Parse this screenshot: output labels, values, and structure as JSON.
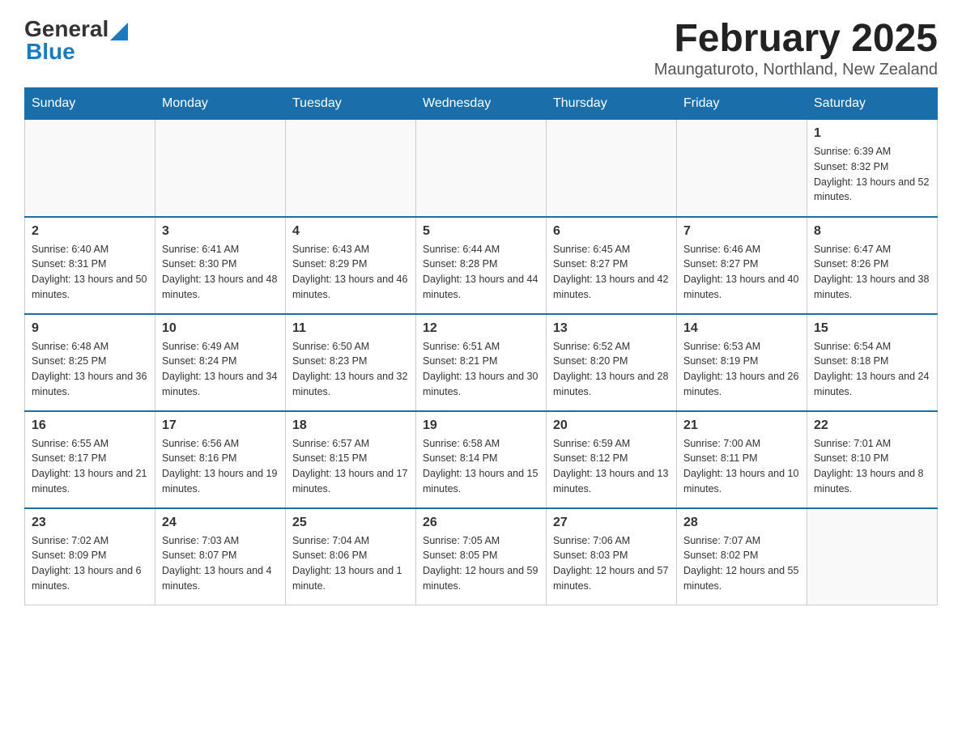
{
  "header": {
    "logo_general": "General",
    "logo_blue": "Blue",
    "title": "February 2025",
    "subtitle": "Maungaturoto, Northland, New Zealand"
  },
  "days_of_week": [
    "Sunday",
    "Monday",
    "Tuesday",
    "Wednesday",
    "Thursday",
    "Friday",
    "Saturday"
  ],
  "weeks": [
    {
      "days": [
        {
          "number": "",
          "info": ""
        },
        {
          "number": "",
          "info": ""
        },
        {
          "number": "",
          "info": ""
        },
        {
          "number": "",
          "info": ""
        },
        {
          "number": "",
          "info": ""
        },
        {
          "number": "",
          "info": ""
        },
        {
          "number": "1",
          "info": "Sunrise: 6:39 AM\nSunset: 8:32 PM\nDaylight: 13 hours and 52 minutes."
        }
      ]
    },
    {
      "days": [
        {
          "number": "2",
          "info": "Sunrise: 6:40 AM\nSunset: 8:31 PM\nDaylight: 13 hours and 50 minutes."
        },
        {
          "number": "3",
          "info": "Sunrise: 6:41 AM\nSunset: 8:30 PM\nDaylight: 13 hours and 48 minutes."
        },
        {
          "number": "4",
          "info": "Sunrise: 6:43 AM\nSunset: 8:29 PM\nDaylight: 13 hours and 46 minutes."
        },
        {
          "number": "5",
          "info": "Sunrise: 6:44 AM\nSunset: 8:28 PM\nDaylight: 13 hours and 44 minutes."
        },
        {
          "number": "6",
          "info": "Sunrise: 6:45 AM\nSunset: 8:27 PM\nDaylight: 13 hours and 42 minutes."
        },
        {
          "number": "7",
          "info": "Sunrise: 6:46 AM\nSunset: 8:27 PM\nDaylight: 13 hours and 40 minutes."
        },
        {
          "number": "8",
          "info": "Sunrise: 6:47 AM\nSunset: 8:26 PM\nDaylight: 13 hours and 38 minutes."
        }
      ]
    },
    {
      "days": [
        {
          "number": "9",
          "info": "Sunrise: 6:48 AM\nSunset: 8:25 PM\nDaylight: 13 hours and 36 minutes."
        },
        {
          "number": "10",
          "info": "Sunrise: 6:49 AM\nSunset: 8:24 PM\nDaylight: 13 hours and 34 minutes."
        },
        {
          "number": "11",
          "info": "Sunrise: 6:50 AM\nSunset: 8:23 PM\nDaylight: 13 hours and 32 minutes."
        },
        {
          "number": "12",
          "info": "Sunrise: 6:51 AM\nSunset: 8:21 PM\nDaylight: 13 hours and 30 minutes."
        },
        {
          "number": "13",
          "info": "Sunrise: 6:52 AM\nSunset: 8:20 PM\nDaylight: 13 hours and 28 minutes."
        },
        {
          "number": "14",
          "info": "Sunrise: 6:53 AM\nSunset: 8:19 PM\nDaylight: 13 hours and 26 minutes."
        },
        {
          "number": "15",
          "info": "Sunrise: 6:54 AM\nSunset: 8:18 PM\nDaylight: 13 hours and 24 minutes."
        }
      ]
    },
    {
      "days": [
        {
          "number": "16",
          "info": "Sunrise: 6:55 AM\nSunset: 8:17 PM\nDaylight: 13 hours and 21 minutes."
        },
        {
          "number": "17",
          "info": "Sunrise: 6:56 AM\nSunset: 8:16 PM\nDaylight: 13 hours and 19 minutes."
        },
        {
          "number": "18",
          "info": "Sunrise: 6:57 AM\nSunset: 8:15 PM\nDaylight: 13 hours and 17 minutes."
        },
        {
          "number": "19",
          "info": "Sunrise: 6:58 AM\nSunset: 8:14 PM\nDaylight: 13 hours and 15 minutes."
        },
        {
          "number": "20",
          "info": "Sunrise: 6:59 AM\nSunset: 8:12 PM\nDaylight: 13 hours and 13 minutes."
        },
        {
          "number": "21",
          "info": "Sunrise: 7:00 AM\nSunset: 8:11 PM\nDaylight: 13 hours and 10 minutes."
        },
        {
          "number": "22",
          "info": "Sunrise: 7:01 AM\nSunset: 8:10 PM\nDaylight: 13 hours and 8 minutes."
        }
      ]
    },
    {
      "days": [
        {
          "number": "23",
          "info": "Sunrise: 7:02 AM\nSunset: 8:09 PM\nDaylight: 13 hours and 6 minutes."
        },
        {
          "number": "24",
          "info": "Sunrise: 7:03 AM\nSunset: 8:07 PM\nDaylight: 13 hours and 4 minutes."
        },
        {
          "number": "25",
          "info": "Sunrise: 7:04 AM\nSunset: 8:06 PM\nDaylight: 13 hours and 1 minute."
        },
        {
          "number": "26",
          "info": "Sunrise: 7:05 AM\nSunset: 8:05 PM\nDaylight: 12 hours and 59 minutes."
        },
        {
          "number": "27",
          "info": "Sunrise: 7:06 AM\nSunset: 8:03 PM\nDaylight: 12 hours and 57 minutes."
        },
        {
          "number": "28",
          "info": "Sunrise: 7:07 AM\nSunset: 8:02 PM\nDaylight: 12 hours and 55 minutes."
        },
        {
          "number": "",
          "info": ""
        }
      ]
    }
  ]
}
